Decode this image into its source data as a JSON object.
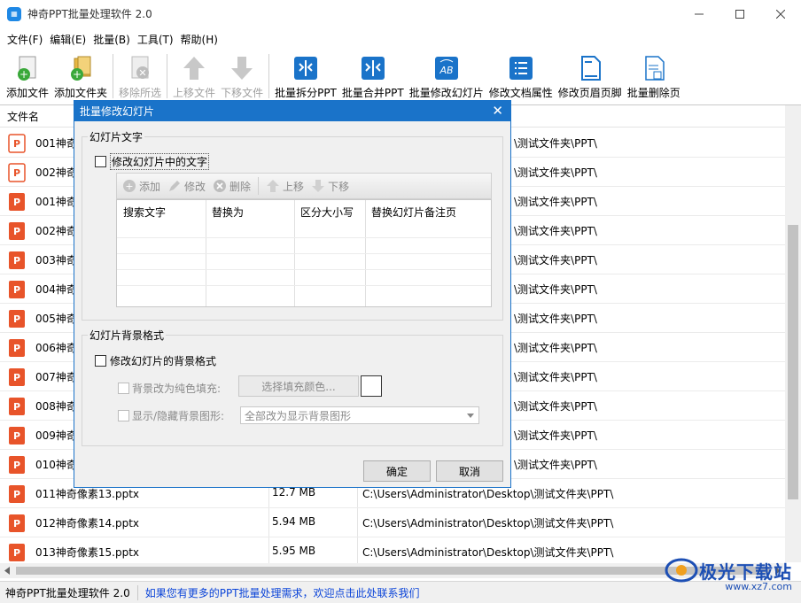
{
  "window": {
    "title": "神奇PPT批量处理软件 2.0",
    "app_icon_glyph": "▦"
  },
  "menu": [
    "文件(F)",
    "编辑(E)",
    "批量(B)",
    "工具(T)",
    "帮助(H)"
  ],
  "toolbar": {
    "add_file": "添加文件",
    "add_folder": "添加文件夹",
    "remove_selected": "移除所选",
    "move_up": "上移文件",
    "move_down": "下移文件",
    "batch_split": "批量拆分PPT",
    "batch_merge": "批量合并PPT",
    "batch_modify_slides": "批量修改幻灯片",
    "modify_doc_props": "修改文档属性",
    "modify_header_footer": "修改页眉页脚",
    "batch_delete_pages": "批量删除页"
  },
  "file_list": {
    "header_name": "文件名",
    "rows": [
      {
        "name": "001神奇",
        "size": "",
        "path": "\\测试文件夹\\PPT\\"
      },
      {
        "name": "002神奇",
        "size": "",
        "path": "\\测试文件夹\\PPT\\"
      },
      {
        "name": "001神奇",
        "size": "",
        "path": "\\测试文件夹\\PPT\\"
      },
      {
        "name": "002神奇",
        "size": "",
        "path": "\\测试文件夹\\PPT\\"
      },
      {
        "name": "003神奇",
        "size": "",
        "path": "\\测试文件夹\\PPT\\"
      },
      {
        "name": "004神奇",
        "size": "",
        "path": "\\测试文件夹\\PPT\\"
      },
      {
        "name": "005神奇",
        "size": "",
        "path": "\\测试文件夹\\PPT\\"
      },
      {
        "name": "006神奇",
        "size": "",
        "path": "\\测试文件夹\\PPT\\"
      },
      {
        "name": "007神奇",
        "size": "",
        "path": "\\测试文件夹\\PPT\\"
      },
      {
        "name": "008神奇",
        "size": "",
        "path": "\\测试文件夹\\PPT\\"
      },
      {
        "name": "009神奇",
        "size": "",
        "path": "\\测试文件夹\\PPT\\"
      },
      {
        "name": "010神奇",
        "size": "",
        "path": "\\测试文件夹\\PPT\\"
      },
      {
        "name": "011神奇像素13.pptx",
        "size": "12.7 MB",
        "path": "C:\\Users\\Administrator\\Desktop\\测试文件夹\\PPT\\"
      },
      {
        "name": "012神奇像素14.pptx",
        "size": "5.94 MB",
        "path": "C:\\Users\\Administrator\\Desktop\\测试文件夹\\PPT\\"
      },
      {
        "name": "013神奇像素15.pptx",
        "size": "5.95 MB",
        "path": "C:\\Users\\Administrator\\Desktop\\测试文件夹\\PPT\\"
      }
    ]
  },
  "dialog": {
    "title": "批量修改幻灯片",
    "text_group": "幻灯片文字",
    "modify_text_checkbox": "修改幻灯片中的文字",
    "add": "添加",
    "edit": "修改",
    "delete": "删除",
    "up": "上移",
    "down": "下移",
    "col_search": "搜索文字",
    "col_replace": "替换为",
    "col_case": "区分大小写",
    "col_notes": "替换幻灯片备注页",
    "bg_group": "幻灯片背景格式",
    "modify_bg_checkbox": "修改幻灯片的背景格式",
    "solid_fill_label": "背景改为纯色填充:",
    "choose_color": "选择填充颜色...",
    "show_hide_label": "显示/隐藏背景图形:",
    "show_hide_value": "全部改为显示背景图形",
    "ok": "确定",
    "cancel": "取消"
  },
  "status": {
    "left": "神奇PPT批量处理软件 2.0",
    "right": "如果您有更多的PPT批量处理需求，欢迎点击此处联系我们"
  },
  "watermark": {
    "text": "极光下载站",
    "sub": "www.xz7.com"
  },
  "colors": {
    "accent": "#1a73c9",
    "ppt_orange": "#e8542a",
    "link_blue": "#0b44d8"
  }
}
